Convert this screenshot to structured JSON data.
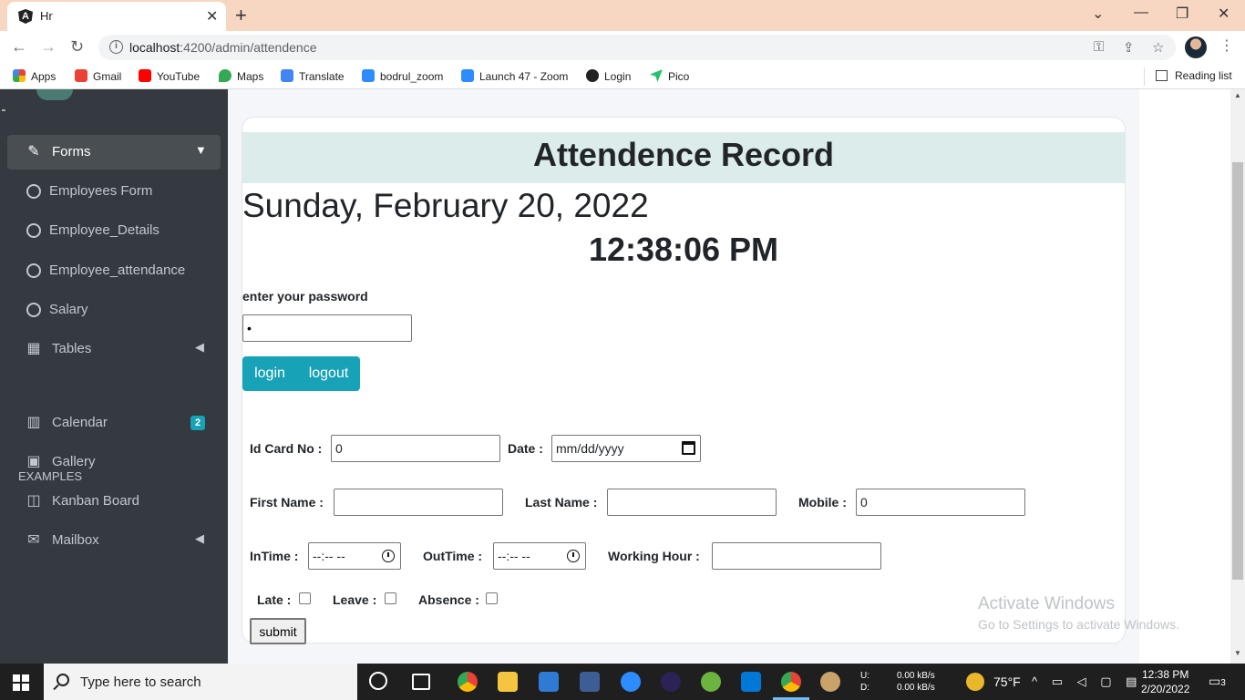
{
  "browser": {
    "tab_title": "Hr",
    "url_host": "localhost",
    "url_path": ":4200/admin/attendence",
    "bookmarks": [
      "Apps",
      "Gmail",
      "YouTube",
      "Maps",
      "Translate",
      "bodrul_zoom",
      "Launch 47 - Zoom",
      "Login",
      "Pico"
    ],
    "reading_list": "Reading list"
  },
  "sidebar": {
    "forms": "Forms",
    "sub_items": [
      "Employees Form",
      "Employee_Details",
      "Employee_attendance",
      "Salary"
    ],
    "tables": "Tables",
    "header": "EXAMPLES",
    "calendar": "Calendar",
    "calendar_badge": "2",
    "gallery": "Gallery",
    "kanban": "Kanban Board",
    "mailbox": "Mailbox"
  },
  "card": {
    "title": "Attendence Record",
    "date": "Sunday, February 20, 2022",
    "time": "12:38:06 PM"
  },
  "password": {
    "label": "enter your password",
    "value": "•"
  },
  "buttons": {
    "login": "login",
    "logout": "logout",
    "submit": "submit"
  },
  "form": {
    "id_card_label": "Id Card No :",
    "id_card_value": "0",
    "date_label": "Date :",
    "date_placeholder": "mm/dd/yyyy",
    "first_name_label": "First Name :",
    "first_name_value": "",
    "last_name_label": "Last Name :",
    "last_name_value": "",
    "mobile_label": "Mobile :",
    "mobile_value": "0",
    "intime_label": "InTime :",
    "intime_value": "--:-- --",
    "outtime_label": "OutTime :",
    "outtime_value": "--:-- --",
    "working_hour_label": "Working Hour :",
    "working_hour_value": "",
    "late_label": "Late :",
    "leave_label": "Leave :",
    "absence_label": "Absence :"
  },
  "watermark": {
    "line1": "Activate Windows",
    "line2": "Go to Settings to activate Windows."
  },
  "taskbar": {
    "search_placeholder": "Type here to search",
    "net_labels": [
      "U:",
      "D:"
    ],
    "net_values": [
      "0.00 kB/s",
      "0.00 kB/s"
    ],
    "temperature": "75°F",
    "time": "12:38 PM",
    "date": "2/20/2022",
    "notifications": "3"
  }
}
